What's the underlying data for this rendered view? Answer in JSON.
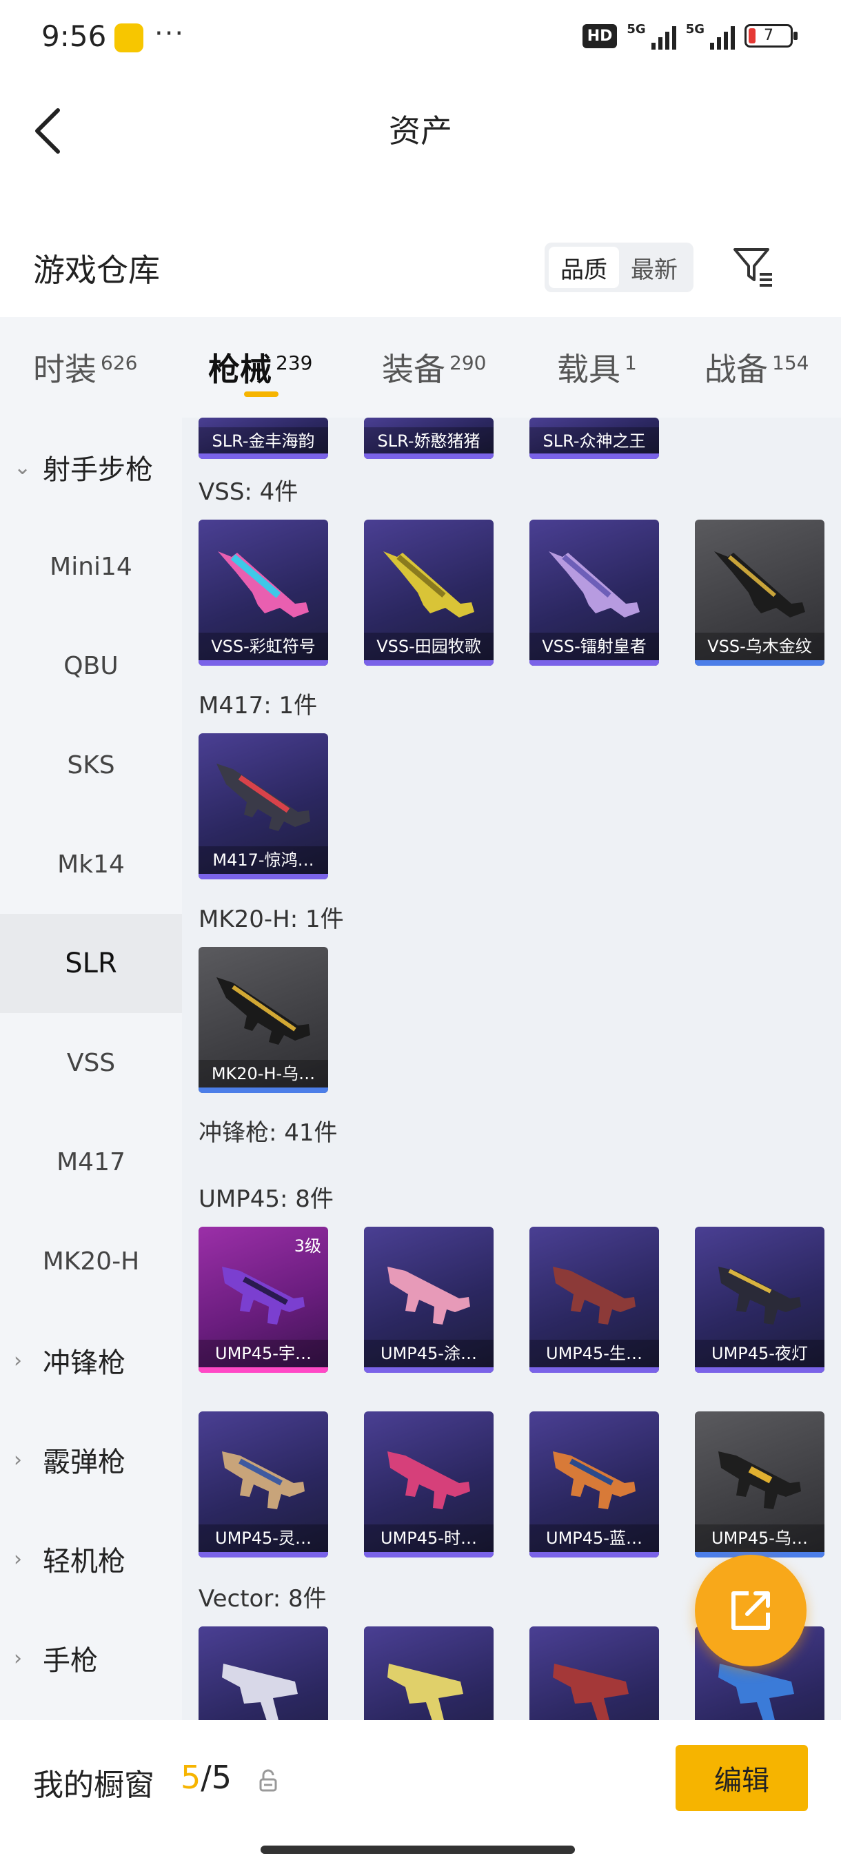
{
  "status_bar": {
    "time": "9:56",
    "more": "···",
    "network_badge": "HD",
    "signal_1": "5G",
    "signal_2": "5G",
    "battery": "7"
  },
  "header": {
    "title": "资产",
    "back_icon": "chevron-left-icon"
  },
  "warehouse": {
    "title": "游戏仓库",
    "sort_options": [
      "品质",
      "最新"
    ],
    "active_sort": "品质",
    "filter_icon": "filter-icon"
  },
  "tabs": [
    {
      "label": "时装",
      "count": "626"
    },
    {
      "label": "枪械",
      "count": "239",
      "active": true
    },
    {
      "label": "装备",
      "count": "290"
    },
    {
      "label": "载具",
      "count": "1"
    },
    {
      "label": "战备",
      "count": "154"
    }
  ],
  "sidebar": {
    "items": [
      {
        "label": "射手步枪",
        "type": "group",
        "expanded": true
      },
      {
        "label": "Mini14"
      },
      {
        "label": "QBU"
      },
      {
        "label": "SKS"
      },
      {
        "label": "Mk14"
      },
      {
        "label": "SLR",
        "active": true
      },
      {
        "label": "VSS"
      },
      {
        "label": "M417"
      },
      {
        "label": "MK20-H"
      },
      {
        "label": "冲锋枪",
        "type": "group"
      },
      {
        "label": "霰弹枪",
        "type": "group"
      },
      {
        "label": "轻机枪",
        "type": "group"
      },
      {
        "label": "手枪",
        "type": "group"
      }
    ]
  },
  "content": {
    "slr_partial": [
      "SLR-金丰海韵",
      "SLR-娇憨猪猪",
      "SLR-众神之王"
    ],
    "sections": [
      {
        "label": "VSS: 4件",
        "items": [
          {
            "name": "VSS-彩虹符号",
            "style": "purple"
          },
          {
            "name": "VSS-田园牧歌",
            "style": "purple"
          },
          {
            "name": "VSS-镭射皇者",
            "style": "purple"
          },
          {
            "name": "VSS-乌木金纹",
            "style": "grey"
          }
        ]
      },
      {
        "label": "M417: 1件",
        "items": [
          {
            "name": "M417-惊鸿…",
            "style": "purple"
          }
        ]
      },
      {
        "label": "MK20-H: 1件",
        "items": [
          {
            "name": "MK20-H-乌…",
            "style": "grey"
          }
        ]
      },
      {
        "label": "冲锋枪: 41件"
      },
      {
        "label": "UMP45: 8件",
        "items": [
          {
            "name": "UMP45-宇…",
            "style": "pink",
            "level": "3级"
          },
          {
            "name": "UMP45-涂…",
            "style": "purple"
          },
          {
            "name": "UMP45-生…",
            "style": "purple"
          },
          {
            "name": "UMP45-夜灯",
            "style": "purple"
          },
          {
            "name": "UMP45-灵…",
            "style": "purple"
          },
          {
            "name": "UMP45-时…",
            "style": "purple"
          },
          {
            "name": "UMP45-蓝…",
            "style": "purple"
          },
          {
            "name": "UMP45-乌…",
            "style": "grey"
          }
        ]
      },
      {
        "label": "Vector: 8件"
      }
    ]
  },
  "fab": {
    "icon": "share-external-icon"
  },
  "bottom_bar": {
    "showcase_label": "我的橱窗",
    "showcase_current": "5",
    "showcase_sep": "/",
    "showcase_total": "5",
    "lock_icon": "lock-icon",
    "edit_label": "编辑"
  },
  "colors": {
    "accent": "#f6b400",
    "fab": "#f8a81a",
    "card_purple": "#2b2760",
    "card_grey": "#3e3e42",
    "card_pink": "#6a1d7e"
  }
}
